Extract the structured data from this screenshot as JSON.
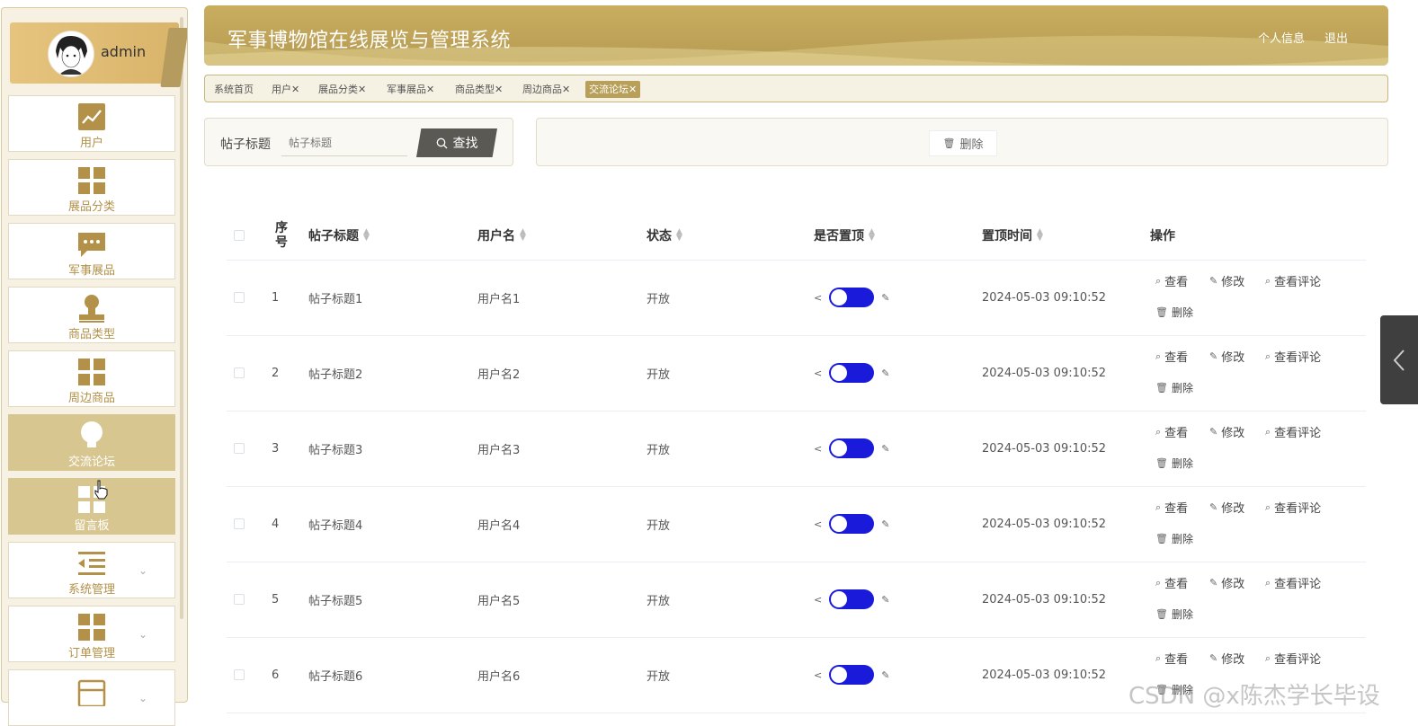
{
  "colors": {
    "accent": "#b8a05b",
    "switch_on": "#1a1adb",
    "menu_icon": "#b39148"
  },
  "sidebar": {
    "user": "admin",
    "items": [
      {
        "label": "用户",
        "icon": "chart-line-icon",
        "active": false
      },
      {
        "label": "展品分类",
        "icon": "grid-icon",
        "active": false
      },
      {
        "label": "军事展品",
        "icon": "chat-bubble-icon",
        "active": false
      },
      {
        "label": "商品类型",
        "icon": "person-icon",
        "active": false
      },
      {
        "label": "周边商品",
        "icon": "grid-icon",
        "active": false
      },
      {
        "label": "交流论坛",
        "icon": "lightbulb-icon",
        "active": true
      },
      {
        "label": "留言板",
        "icon": "grid-icon",
        "active": true
      },
      {
        "label": "系统管理",
        "icon": "list-indent-icon",
        "active": false,
        "expandable": true
      },
      {
        "label": "订单管理",
        "icon": "grid-icon",
        "active": false,
        "expandable": true
      },
      {
        "label": "",
        "icon": "cabinet-icon",
        "active": false,
        "expandable": true
      }
    ]
  },
  "header": {
    "title": "军事博物馆在线展览与管理系统",
    "profile_link": "个人信息",
    "logout_link": "退出"
  },
  "tabs": [
    {
      "label": "系统首页",
      "closable": false
    },
    {
      "label": "用户",
      "closable": true
    },
    {
      "label": "展品分类",
      "closable": true
    },
    {
      "label": "军事展品",
      "closable": true
    },
    {
      "label": "商品类型",
      "closable": true
    },
    {
      "label": "周边商品",
      "closable": true
    },
    {
      "label": "交流论坛",
      "closable": true,
      "active": true
    }
  ],
  "search": {
    "label": "帖子标题",
    "placeholder": "帖子标题",
    "button_label": "查找"
  },
  "actions": {
    "delete_label": "删除"
  },
  "table": {
    "headers": {
      "index": "序号",
      "title": "帖子标题",
      "username": "用户名",
      "status": "状态",
      "pinned": "是否置顶",
      "pin_time": "置顶时间",
      "ops": "操作"
    },
    "op_labels": {
      "view": "查看",
      "edit": "修改",
      "comments": "查看评论",
      "delete": "删除"
    },
    "rows": [
      {
        "index": "1",
        "title": "帖子标题1",
        "username": "用户名1",
        "status": "开放",
        "pinned": true,
        "pin_time": "2024-05-03 09:10:52"
      },
      {
        "index": "2",
        "title": "帖子标题2",
        "username": "用户名2",
        "status": "开放",
        "pinned": true,
        "pin_time": "2024-05-03 09:10:52"
      },
      {
        "index": "3",
        "title": "帖子标题3",
        "username": "用户名3",
        "status": "开放",
        "pinned": true,
        "pin_time": "2024-05-03 09:10:52"
      },
      {
        "index": "4",
        "title": "帖子标题4",
        "username": "用户名4",
        "status": "开放",
        "pinned": true,
        "pin_time": "2024-05-03 09:10:52"
      },
      {
        "index": "5",
        "title": "帖子标题5",
        "username": "用户名5",
        "status": "开放",
        "pinned": true,
        "pin_time": "2024-05-03 09:10:52"
      },
      {
        "index": "6",
        "title": "帖子标题6",
        "username": "用户名6",
        "status": "开放",
        "pinned": true,
        "pin_time": "2024-05-03 09:10:52"
      }
    ]
  },
  "watermark": "CSDN @x陈杰学长毕设"
}
